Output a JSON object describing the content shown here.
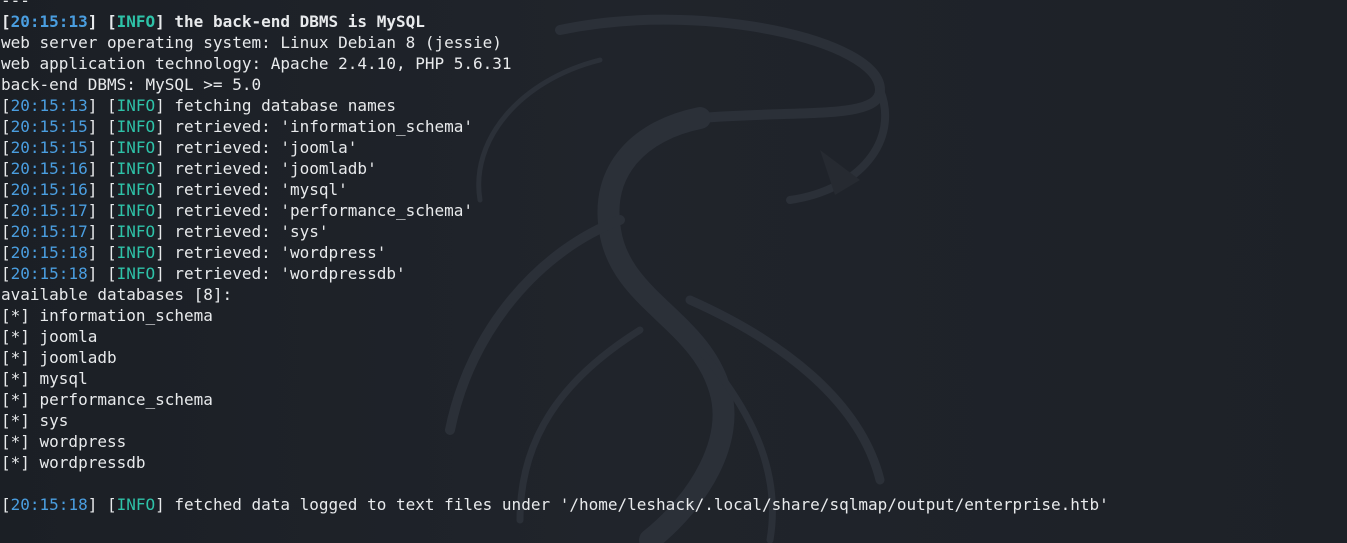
{
  "colors": {
    "background": "#1c2026",
    "text": "#e8eaec",
    "timestamp": "#4a9ee0",
    "info_tag": "#2ec2a8"
  },
  "background_logo": "kali-dragon-icon",
  "terminal": {
    "lines": [
      {
        "type": "text",
        "text": "---"
      },
      {
        "type": "log",
        "bold": true,
        "time": "20:15:13",
        "level": "INFO",
        "message": "the back-end DBMS is MySQL"
      },
      {
        "type": "text",
        "text": "web server operating system: Linux Debian 8 (jessie)"
      },
      {
        "type": "text",
        "text": "web application technology: Apache 2.4.10, PHP 5.6.31"
      },
      {
        "type": "text",
        "text": "back-end DBMS: MySQL >= 5.0"
      },
      {
        "type": "log",
        "time": "20:15:13",
        "level": "INFO",
        "message": "fetching database names"
      },
      {
        "type": "log",
        "time": "20:15:15",
        "level": "INFO",
        "message": "retrieved: 'information_schema'"
      },
      {
        "type": "log",
        "time": "20:15:15",
        "level": "INFO",
        "message": "retrieved: 'joomla'"
      },
      {
        "type": "log",
        "time": "20:15:16",
        "level": "INFO",
        "message": "retrieved: 'joomladb'"
      },
      {
        "type": "log",
        "time": "20:15:16",
        "level": "INFO",
        "message": "retrieved: 'mysql'"
      },
      {
        "type": "log",
        "time": "20:15:17",
        "level": "INFO",
        "message": "retrieved: 'performance_schema'"
      },
      {
        "type": "log",
        "time": "20:15:17",
        "level": "INFO",
        "message": "retrieved: 'sys'"
      },
      {
        "type": "log",
        "time": "20:15:18",
        "level": "INFO",
        "message": "retrieved: 'wordpress'"
      },
      {
        "type": "log",
        "time": "20:15:18",
        "level": "INFO",
        "message": "retrieved: 'wordpressdb'"
      },
      {
        "type": "text",
        "text": "available databases [8]:"
      },
      {
        "type": "text",
        "text": "[*] information_schema"
      },
      {
        "type": "text",
        "text": "[*] joomla"
      },
      {
        "type": "text",
        "text": "[*] joomladb"
      },
      {
        "type": "text",
        "text": "[*] mysql"
      },
      {
        "type": "text",
        "text": "[*] performance_schema"
      },
      {
        "type": "text",
        "text": "[*] sys"
      },
      {
        "type": "text",
        "text": "[*] wordpress"
      },
      {
        "type": "text",
        "text": "[*] wordpressdb"
      },
      {
        "type": "text",
        "text": ""
      },
      {
        "type": "log",
        "time": "20:15:18",
        "level": "INFO",
        "message": "fetched data logged to text files under '/home/leshack/.local/share/sqlmap/output/enterprise.htb'"
      }
    ]
  }
}
